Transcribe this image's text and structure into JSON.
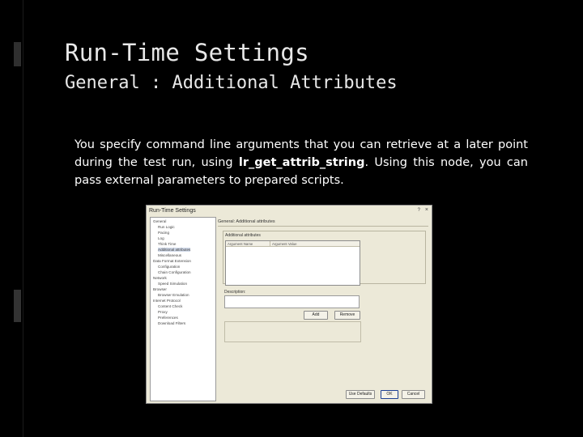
{
  "slide": {
    "title": "Run-Time Settings",
    "subtitle": "General : Additional Attributes",
    "body_pre": "You specify command line arguments that you can retrieve at a later point during the test run, using ",
    "body_code": "lr_get_attrib_string",
    "body_post": ". Using this node, you can pass external parameters to prepared scripts."
  },
  "dialog": {
    "title": "Run-Time Settings",
    "help": "?",
    "close": "×",
    "panel_title": "General: Additional attributes",
    "group_label": "Additional attributes",
    "columns": [
      "Argument Name",
      "Argument Value"
    ],
    "description_label": "Description:",
    "add_button": "Add",
    "remove_button": "Remove",
    "use_defaults_button": "Use Defaults",
    "ok_button": "OK",
    "cancel_button": "Cancel",
    "tree": [
      {
        "label": "General"
      },
      {
        "label": "Run Logic"
      },
      {
        "label": "Pacing"
      },
      {
        "label": "Log"
      },
      {
        "label": "Think Time"
      },
      {
        "label": "Additional attributes"
      },
      {
        "label": "Miscellaneous"
      },
      {
        "label": "Data Format Extension"
      },
      {
        "label": "Configuration"
      },
      {
        "label": "Chain Configuration"
      },
      {
        "label": "Network"
      },
      {
        "label": "Speed Simulation"
      },
      {
        "label": "Browser"
      },
      {
        "label": "Browser Emulation"
      },
      {
        "label": "Internet Protocol"
      },
      {
        "label": "Content Check"
      },
      {
        "label": "Proxy"
      },
      {
        "label": "Preferences"
      },
      {
        "label": "Download Filters"
      }
    ]
  }
}
